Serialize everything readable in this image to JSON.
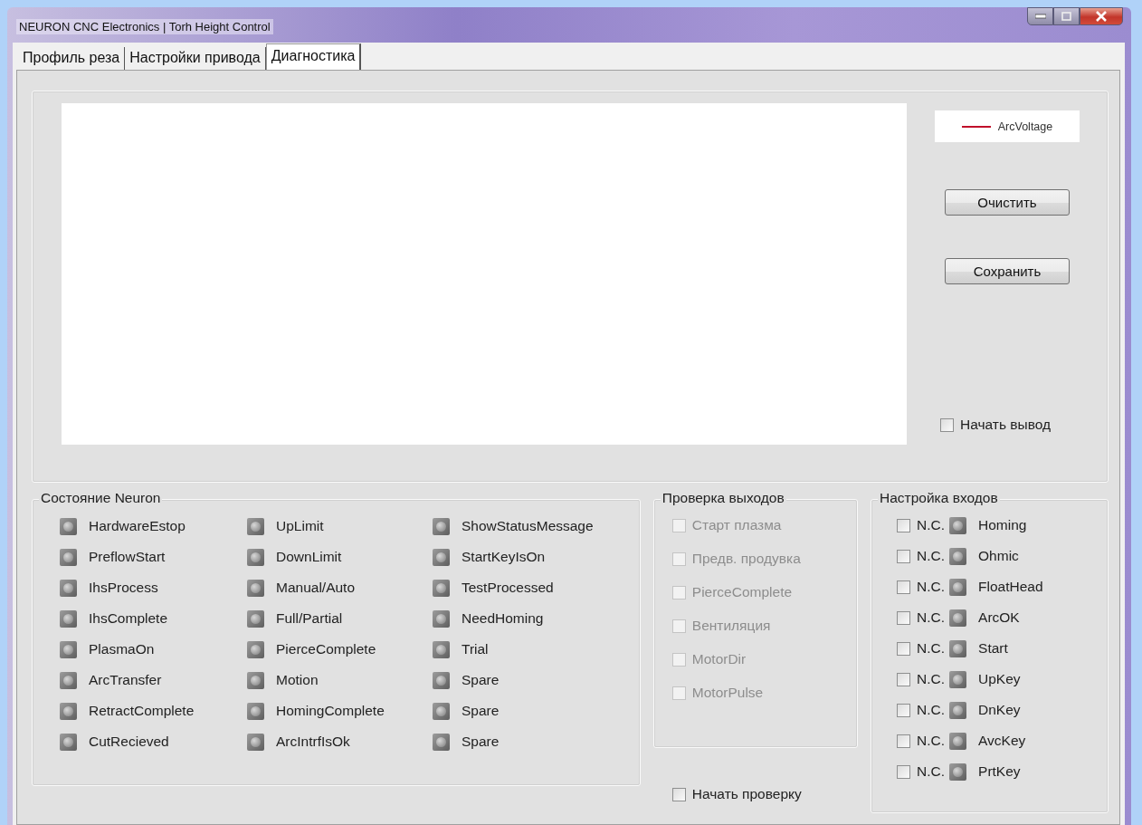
{
  "window": {
    "title": "NEURON CNC Electronics | Torh Height Control"
  },
  "tabs": [
    {
      "label": "Профиль реза",
      "selected": false
    },
    {
      "label": "Настройки привода",
      "selected": false
    },
    {
      "label": "Диагностика",
      "selected": true
    }
  ],
  "chart": {
    "legend": [
      {
        "name": "ArcVoltage"
      }
    ]
  },
  "chart_buttons": [
    "Очистить",
    "Сохранить"
  ],
  "start_output": {
    "label": "Начать вывод",
    "checked": false
  },
  "neuron_status": {
    "title": "Состояние Neuron",
    "columns": [
      [
        {
          "label": "HardwareEstop",
          "on": false
        },
        {
          "label": "PreflowStart",
          "on": false
        },
        {
          "label": "IhsProcess",
          "on": false
        },
        {
          "label": "IhsComplete",
          "on": false
        },
        {
          "label": "PlasmaOn",
          "on": false
        },
        {
          "label": "ArcTransfer",
          "on": false
        },
        {
          "label": "RetractComplete",
          "on": false
        },
        {
          "label": "CutRecieved",
          "on": false
        }
      ],
      [
        {
          "label": "UpLimit",
          "on": false
        },
        {
          "label": "DownLimit",
          "on": false
        },
        {
          "label": "Manual/Auto",
          "on": false
        },
        {
          "label": "Full/Partial",
          "on": false
        },
        {
          "label": "PierceComplete",
          "on": false
        },
        {
          "label": "Motion",
          "on": false
        },
        {
          "label": "HomingComplete",
          "on": false
        },
        {
          "label": "ArcIntrfIsOk",
          "on": false
        }
      ],
      [
        {
          "label": "ShowStatusMessage",
          "on": false
        },
        {
          "label": "StartKeyIsOn",
          "on": false
        },
        {
          "label": "TestProcessed",
          "on": false
        },
        {
          "label": "NeedHoming",
          "on": false
        },
        {
          "label": "Trial",
          "on": false
        },
        {
          "label": "Spare",
          "on": false
        },
        {
          "label": "Spare",
          "on": false
        },
        {
          "label": "Spare",
          "on": false
        }
      ]
    ]
  },
  "output_test": {
    "title": "Проверка выходов",
    "items": [
      {
        "label": "Старт плазма",
        "checked": false,
        "disabled": true
      },
      {
        "label": "Предв. продувка",
        "checked": false,
        "disabled": true
      },
      {
        "label": "PierceComplete",
        "checked": false,
        "disabled": true
      },
      {
        "label": "Вентиляция",
        "checked": false,
        "disabled": true
      },
      {
        "label": "MotorDir",
        "checked": false,
        "disabled": true
      },
      {
        "label": "MotorPulse",
        "checked": false,
        "disabled": true
      }
    ]
  },
  "start_test": {
    "label": "Начать проверку",
    "checked": false
  },
  "input_setup": {
    "title": "Настройка входов",
    "rows": [
      {
        "nc_label": "N.C.",
        "nc_checked": false,
        "input": "Homing",
        "on": false
      },
      {
        "nc_label": "N.C.",
        "nc_checked": false,
        "input": "Ohmic",
        "on": false
      },
      {
        "nc_label": "N.C.",
        "nc_checked": false,
        "input": "FloatHead",
        "on": false
      },
      {
        "nc_label": "N.C.",
        "nc_checked": false,
        "input": "ArcOK",
        "on": false
      },
      {
        "nc_label": "N.C.",
        "nc_checked": false,
        "input": "Start",
        "on": false
      },
      {
        "nc_label": "N.C.",
        "nc_checked": false,
        "input": "UpKey",
        "on": false
      },
      {
        "nc_label": "N.C.",
        "nc_checked": false,
        "input": "DnKey",
        "on": false
      },
      {
        "nc_label": "N.C.",
        "nc_checked": false,
        "input": "AvcKey",
        "on": false
      },
      {
        "nc_label": "N.C.",
        "nc_checked": false,
        "input": "PrtKey",
        "on": false
      }
    ]
  }
}
